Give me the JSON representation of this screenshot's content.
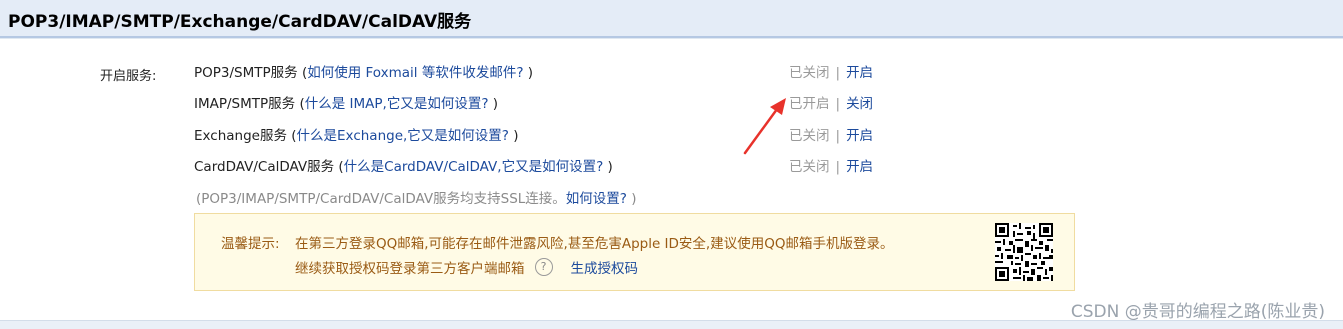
{
  "header": {
    "title": "POP3/IMAP/SMTP/Exchange/CardDAV/CalDAV服务"
  },
  "section_label": "开启服务:",
  "services": [
    {
      "name": "POP3/SMTP服务",
      "paren_open": " (",
      "help_link": "如何使用 Foxmail 等软件收发邮件?",
      "paren_close": " )",
      "state": "已关闭",
      "sep": "|",
      "action": "开启"
    },
    {
      "name": "IMAP/SMTP服务",
      "paren_open": " (",
      "help_link": "什么是 IMAP,它又是如何设置?",
      "paren_close": " )",
      "state": "已开启",
      "sep": "|",
      "action": "关闭"
    },
    {
      "name": "Exchange服务",
      "paren_open": " (",
      "help_link": "什么是Exchange,它又是如何设置?",
      "paren_close": " )",
      "state": "已关闭",
      "sep": "|",
      "action": "开启"
    },
    {
      "name": "CardDAV/CalDAV服务",
      "paren_open": " (",
      "help_link": "什么是CardDAV/CalDAV,它又是如何设置?",
      "paren_close": " )",
      "state": "已关闭",
      "sep": "|",
      "action": "开启"
    }
  ],
  "ssl_note": {
    "text": "(POP3/IMAP/SMTP/CardDAV/CalDAV服务均支持SSL连接。",
    "link": "如何设置?",
    "close": " )"
  },
  "tip": {
    "prefix": "温馨提示:",
    "line1": "在第三方登录QQ邮箱,可能存在邮件泄露风险,甚至危害Apple ID安全,建议使用QQ邮箱手机版登录。",
    "line2": "继续获取授权码登录第三方客户端邮箱",
    "help_icon": "?",
    "link": "生成授权码"
  },
  "watermark": "CSDN @贵哥的编程之路(陈业贵)"
}
